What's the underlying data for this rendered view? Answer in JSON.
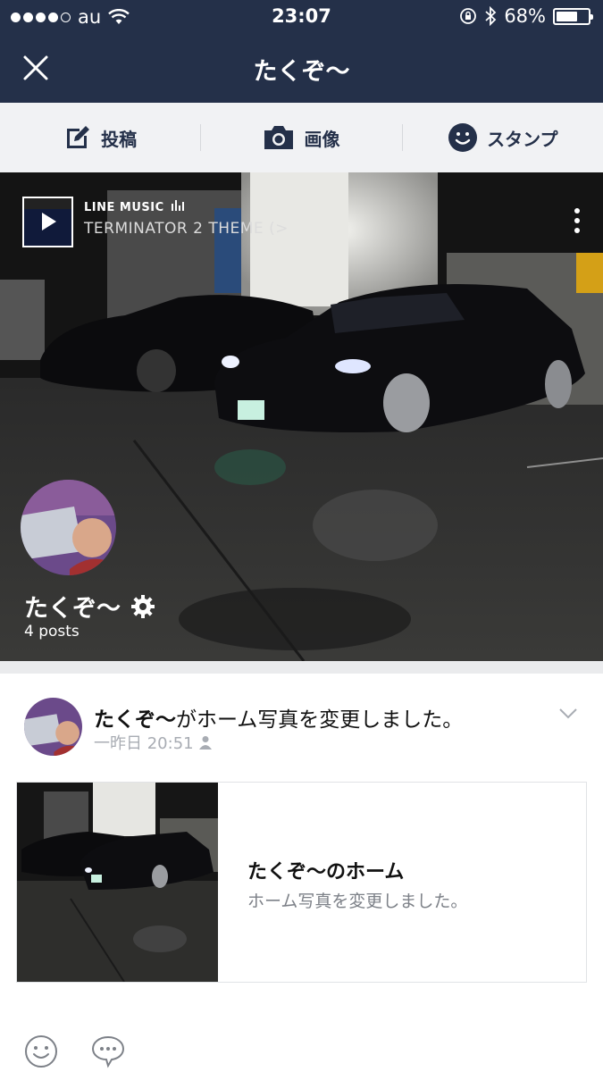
{
  "status": {
    "carrier": "au",
    "time": "23:07",
    "battery": "68%",
    "battery_level": 0.68,
    "icons": [
      "signal-dots-icon",
      "wifi-icon",
      "rotation-lock-icon",
      "bluetooth-icon",
      "battery-icon"
    ]
  },
  "nav": {
    "title": "たくぞ〜",
    "close_icon": "close-icon"
  },
  "actions": [
    {
      "label": "投稿",
      "icon": "edit-icon"
    },
    {
      "label": "画像",
      "icon": "camera-icon"
    },
    {
      "label": "スタンプ",
      "icon": "smile-icon"
    }
  ],
  "cover": {
    "music_source": "LINE MUSIC",
    "music_title": "TERMINATOR 2 THEME (>",
    "profile_name": "たくぞ〜",
    "posts": "4 posts"
  },
  "post": {
    "author": "たくぞ〜",
    "action_text": "がホーム写真を変更しました。",
    "time": "一昨日 20:51",
    "card_title": "たくぞ〜のホーム",
    "card_subtitle": "ホーム写真を変更しました。"
  },
  "colors": {
    "header": "#243049",
    "action_bar": "#f1f2f4",
    "accent_text": "#243049"
  }
}
